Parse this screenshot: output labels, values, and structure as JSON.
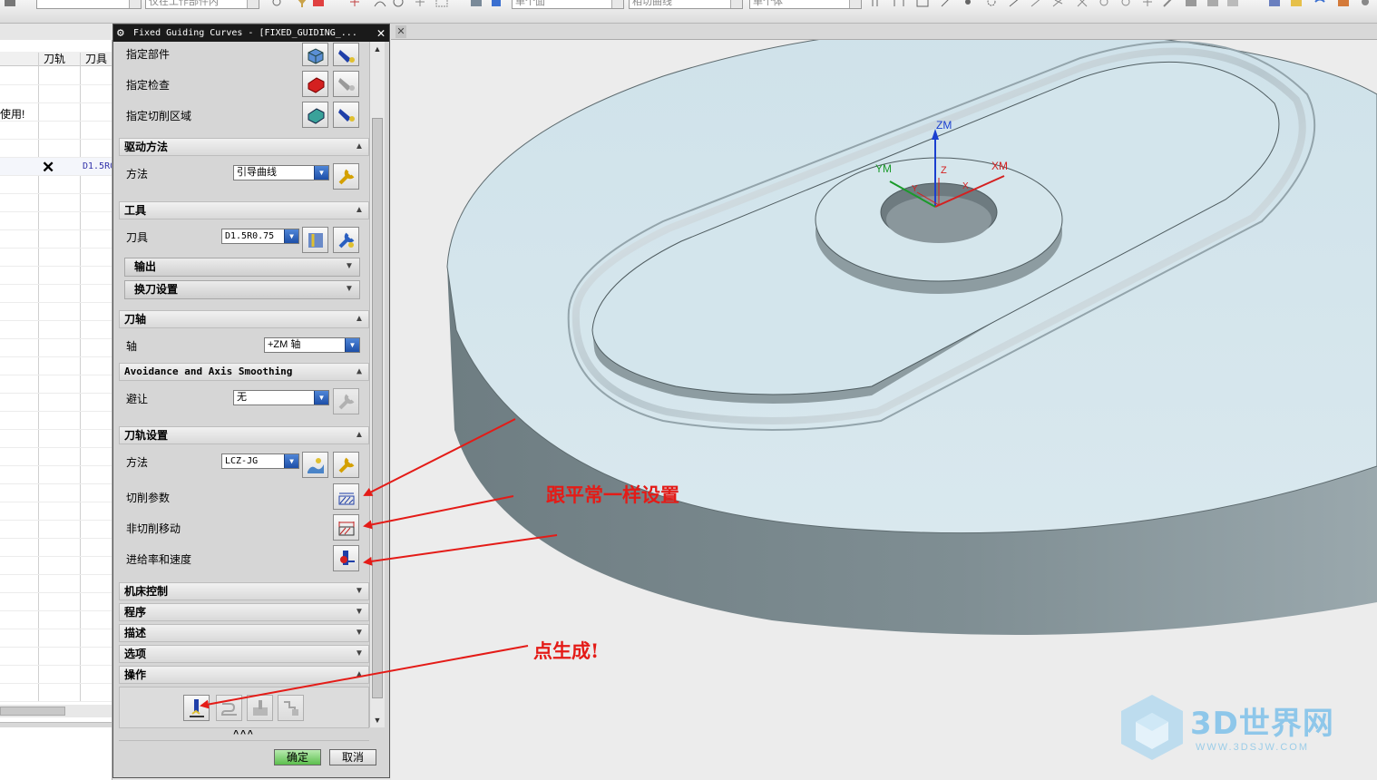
{
  "toolbar": {
    "select_1": "",
    "select_2": "仅在工作部件内",
    "select_3": "单个面",
    "select_4": "相切曲线",
    "select_5": "单个体"
  },
  "navigator": {
    "col_toolpath": "刀轨",
    "col_tool": "刀具",
    "row_use_text": "使用!",
    "row_tool_text": "D1.5R0",
    "status_icon": "x-mark-icon"
  },
  "dialog": {
    "title": "Fixed Guiding Curves - [FIXED_GUIDING_...",
    "geometry": {
      "specify_part": "指定部件",
      "specify_check": "指定检查",
      "specify_cut_area": "指定切削区域"
    },
    "drive_method": {
      "header": "驱动方法",
      "method_label": "方法",
      "method_value": "引导曲线"
    },
    "tool": {
      "header": "工具",
      "tool_label": "刀具",
      "tool_value": "D1.5R0.75",
      "output": "输出",
      "tool_change": "换刀设置"
    },
    "tool_axis": {
      "header": "刀轴",
      "axis_label": "轴",
      "axis_value": "+ZM 轴"
    },
    "avoidance": {
      "header": "Avoidance and Axis Smoothing",
      "label": "避让",
      "value": "无"
    },
    "path_settings": {
      "header": "刀轨设置",
      "method_label": "方法",
      "method_value": "LCZ-JG",
      "cutting_params": "切削参数",
      "non_cutting_moves": "非切削移动",
      "feeds_speeds": "进给率和速度"
    },
    "machine_control": "机床控制",
    "program": "程序",
    "description": "描述",
    "options": "选项",
    "actions": "操作",
    "more": "^^^",
    "ok": "确定",
    "cancel": "取消"
  },
  "viewport": {
    "csys": {
      "zm": "ZM",
      "ym": "YM",
      "xm": "XM",
      "z": "Z",
      "y": "Y",
      "x": "X"
    }
  },
  "annotations": {
    "note_same_as_usual": "跟平常一样设置",
    "note_click_generate": "点生成!"
  },
  "watermark": {
    "text": "3D世界网",
    "url": "WWW.3DSJW.COM"
  },
  "colors": {
    "annotation": "#e41b17",
    "part_top": "#d5e6ec",
    "part_side": "#7d8c91",
    "dialog_bg": "#d6d6d6",
    "watermark": "#8ec7ea"
  }
}
